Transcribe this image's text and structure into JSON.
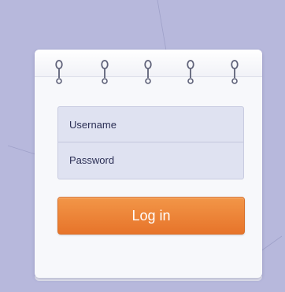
{
  "form": {
    "username_placeholder": "Username",
    "password_placeholder": "Password",
    "login_label": "Log in"
  },
  "theme": {
    "background": "#b7b8dc",
    "button": "#ec8136",
    "field_bg": "#dfe2f1"
  },
  "rings": {
    "icon": "spiral-binding-icon"
  }
}
